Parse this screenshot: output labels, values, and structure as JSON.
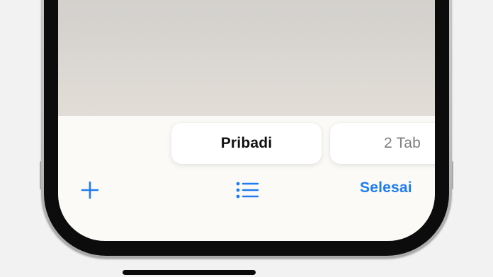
{
  "tab_groups": {
    "active_label": "Pribadi",
    "other_label": "2 Tab"
  },
  "toolbar": {
    "new_tab_icon": "plus-icon",
    "tab_groups_icon": "list-icon",
    "done_label": "Selesai"
  },
  "colors": {
    "accent": "#1f7cf0",
    "frame": "#0c0c0c",
    "toolbar_bg": "#fbfaf7"
  }
}
